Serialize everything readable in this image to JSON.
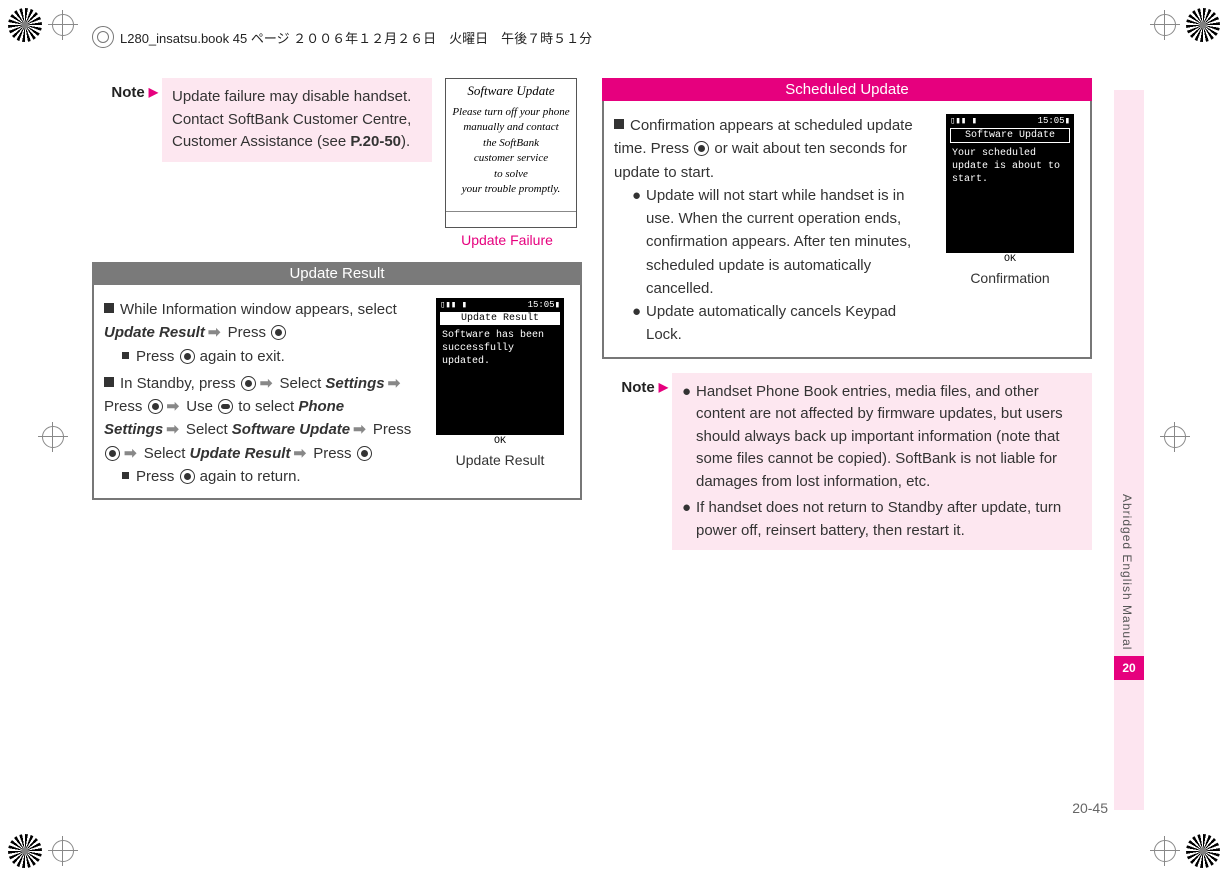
{
  "header": {
    "text": "L280_insatsu.book  45 ページ  ２００６年１２月２６日　火曜日　午後７時５１分"
  },
  "side": {
    "label": "Abridged English Manual",
    "chapter": "20",
    "page": "20-45"
  },
  "col1": {
    "note1_label": "Note",
    "note1_body": "Update failure may disable handset. Contact SoftBank Customer Centre, Customer Assistance (see ",
    "note1_ref": "P.20-50",
    "note1_tail": ").",
    "mock1_title": "Software Update",
    "mock1_body": "Please turn off your phone\nmanually and contact\nthe SoftBank\ncustomer service\nto solve\nyour trouble promptly.",
    "mock1_caption": "Update Failure",
    "box1_title": "Update Result",
    "box1_l1a": "While Information window appears, select ",
    "box1_l1b": "Update Result",
    "box1_l1c": " Press ",
    "box1_sub1": "Press ",
    "box1_sub1b": " again to exit.",
    "box1_l2a": "In Standby, press ",
    "box1_l2b": " Select ",
    "box1_l2c": "Settings",
    "box1_l2d": " Press ",
    "box1_l2e": " Use ",
    "box1_l2f": " to select ",
    "box1_l2g": "Phone Settings",
    "box1_l2h": " Select ",
    "box1_l2i": "Software Update",
    "box1_l2j": " Press ",
    "box1_l2k": " Select ",
    "box1_l2l": "Update Result",
    "box1_l2m": " Press ",
    "box1_sub2": "Press ",
    "box1_sub2b": " again to return.",
    "mock2_title": "Update Result",
    "mock2_status_l": "▯▮▮ ▮",
    "mock2_status_r": "15:05▮",
    "mock2_body": "Software has been\nsuccessfully updated.",
    "mock2_ok": "OK",
    "mock2_caption": "Update Result"
  },
  "col2": {
    "box_title": "Scheduled Update",
    "box_l1": "Confirmation appears at scheduled update time. Press ",
    "box_l1b": " or wait about ten seconds for update to start.",
    "box_b1": "Update will not start while handset is in use. When the current operation ends, confirmation appears. After ten minutes, scheduled update is automatically cancelled.",
    "box_b2": "Update automatically cancels Keypad Lock.",
    "mock_title": "Software Update",
    "mock_status_l": "▯▮▮  ▮",
    "mock_status_r": "15:05▮",
    "mock_body": "Your scheduled\nupdate is about to\nstart.",
    "mock_ok": "OK",
    "mock_caption": "Confirmation",
    "note_label": "Note",
    "note_b1": "Handset Phone Book entries, media files, and other content are not affected by firmware updates, but users should always back up important information (note that some files cannot be copied). SoftBank is not liable for damages from lost information, etc.",
    "note_b2": "If handset does not return to Standby after update, turn power off, reinsert battery, then restart it."
  }
}
